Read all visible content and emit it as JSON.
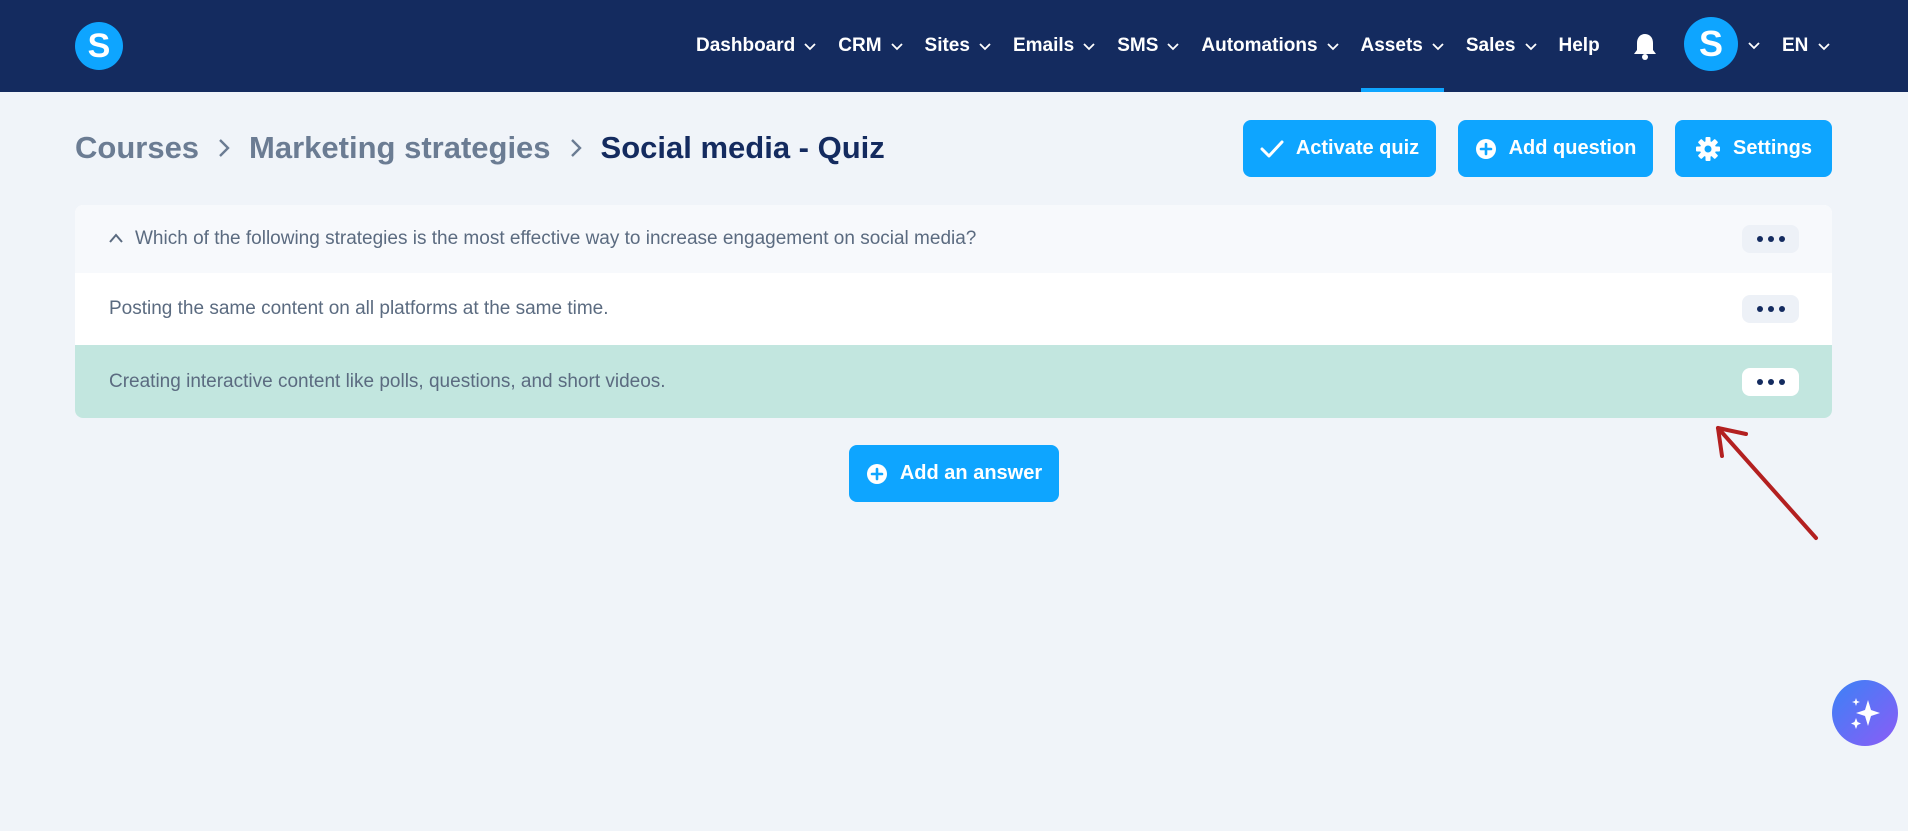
{
  "brand": {
    "logo_letter": "S",
    "accent": "#0ea5ff",
    "nav_bg": "#142b5f"
  },
  "nav": {
    "items": [
      {
        "label": "Dashboard",
        "has_dropdown": true
      },
      {
        "label": "CRM",
        "has_dropdown": true
      },
      {
        "label": "Sites",
        "has_dropdown": true
      },
      {
        "label": "Emails",
        "has_dropdown": true
      },
      {
        "label": "SMS",
        "has_dropdown": true
      },
      {
        "label": "Automations",
        "has_dropdown": true
      },
      {
        "label": "Assets",
        "has_dropdown": true,
        "active": true
      },
      {
        "label": "Sales",
        "has_dropdown": true
      },
      {
        "label": "Help",
        "has_dropdown": false
      }
    ],
    "notification_icon": "bell-icon",
    "avatar_letter": "S",
    "language": "EN"
  },
  "breadcrumb": {
    "items": [
      "Courses",
      "Marketing strategies",
      "Social media - Quiz"
    ]
  },
  "actions": {
    "activate_label": "Activate quiz",
    "add_question_label": "Add question",
    "settings_label": "Settings"
  },
  "quiz": {
    "question": "Which of the following strategies is the most effective way to increase engagement on social media?",
    "answers": [
      {
        "text": "Posting the same content on all platforms at the same time.",
        "correct": false
      },
      {
        "text": "Creating interactive content like polls, questions, and short videos.",
        "correct": true
      }
    ],
    "correct_color": "#c2e6df"
  },
  "add_answer_label": "Add an answer"
}
